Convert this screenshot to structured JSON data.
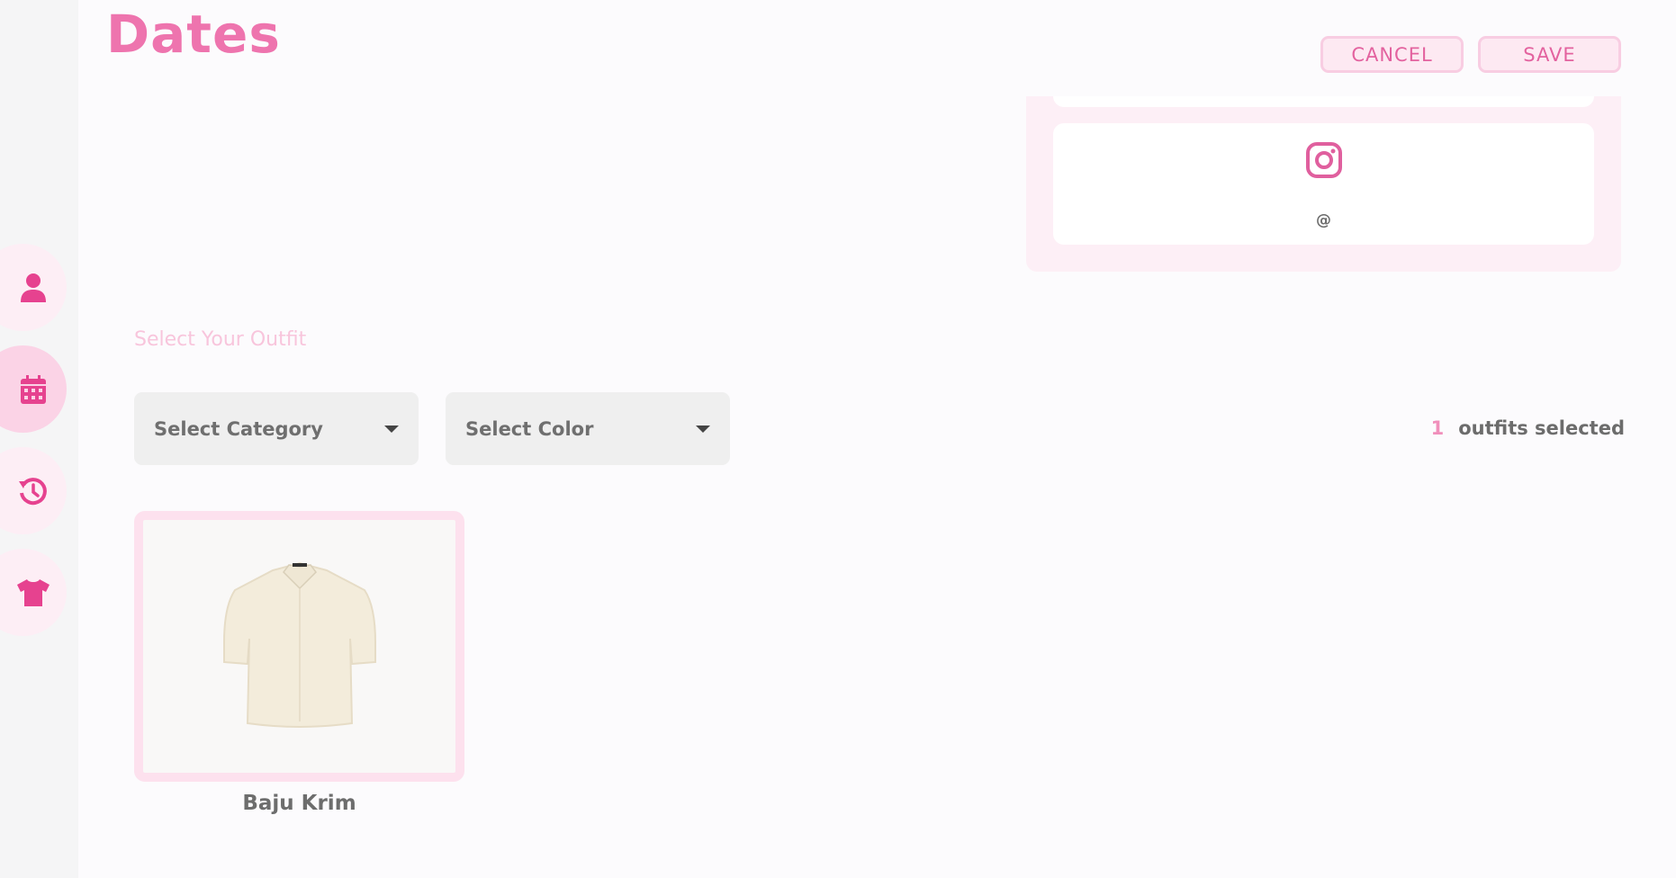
{
  "page": {
    "title": "Dates"
  },
  "actions": {
    "cancel_label": "CANCEL",
    "save_label": "SAVE"
  },
  "sidebar": {
    "items": [
      {
        "icon": "person-icon",
        "active": false
      },
      {
        "icon": "calendar-icon",
        "active": true
      },
      {
        "icon": "history-icon",
        "active": false
      },
      {
        "icon": "shirt-icon",
        "active": false
      }
    ]
  },
  "social": {
    "platform_icon": "instagram-icon",
    "handle": "@"
  },
  "outfit": {
    "section_label": "Select Your Outfit",
    "category_placeholder": "Select Category",
    "color_placeholder": "Select Color",
    "selected_count": "1",
    "selected_label": "outfits selected",
    "items": [
      {
        "name": "Baju Krim",
        "selected": true
      }
    ]
  },
  "colors": {
    "accent": "#ee74ae",
    "icon": "#e6428f",
    "panel": "#fdeff6"
  }
}
